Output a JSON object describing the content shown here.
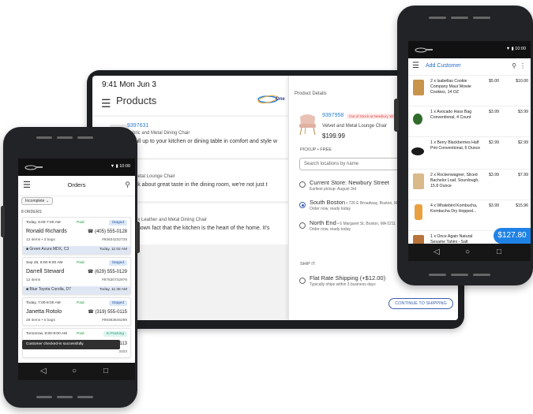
{
  "tablet": {
    "status_time": "9:41",
    "status_date": "Mon Jun 3",
    "title": "Products",
    "logo_text": "One",
    "list": [
      {
        "sku": "9397631",
        "name": "Fabric and Metal Dining Chair",
        "desc": "'ll pull up to your kitchen or dining table in comfort and style w"
      },
      {
        "sku": "3",
        "name": "nd Metal Lounge Chair",
        "desc": "e talk about great taste in the dining room, we're not just t"
      },
      {
        "sku": "5",
        "name": "l Faux Leather and Metal Dining Chair",
        "desc": "ell-known fact that the kitchen is the heart of the home. It's"
      }
    ],
    "details": {
      "header": "Product Details",
      "sku": "9397958",
      "badge": "Out of Stock at Newbury Street",
      "name": "Velvet and Metal Lounge Chair",
      "price": "$199.99",
      "pickup_label": "PICKUP • FREE",
      "search_placeholder": "Search locations by name",
      "options": [
        {
          "name": "Current Store: Newbury Street",
          "detail": "",
          "sub": "Earliest pickup: August 3rd"
        },
        {
          "name": "South Boston",
          "detail": " • 726 E Broadway, Boston, Ma",
          "sub": "Order now, ready today"
        },
        {
          "name": "North End",
          "detail": " • 6 Margaret St, Boston, MA 0211",
          "sub": "Order now, ready today"
        }
      ],
      "ship_label": "SHIP IT",
      "ship_option": {
        "name": "Flat Rate Shipping (+$12.00)",
        "sub": "Typically ships within 3 business days"
      },
      "continue_label": "CONTINUE TO SHIPPING"
    }
  },
  "left_phone": {
    "status_time": "10:00",
    "title": "Orders",
    "filter": "Incomplete",
    "count": "8 ORDERS",
    "orders": [
      {
        "time": "Today, 6:00-7:00 AM",
        "paid": "Paid",
        "status": "Staged",
        "name": "Ronald Richards",
        "phone": "(405) 555-0128",
        "items": "12 items • 3 bags",
        "order_no": "#93634232725",
        "car": "Green Acura MDX, C3",
        "ready": "Today, 11:02 AM"
      },
      {
        "time": "Sep 28, 8:00-9:00 AM",
        "paid": "Paid",
        "status": "Staged",
        "name": "Darrell Steward",
        "phone": "(629) 555-0129",
        "items": "12 items",
        "order_no": "#87530742976",
        "car": "Blue Toyota Corolla, D7",
        "ready": "Today, 11:38 AM"
      },
      {
        "time": "Today, 7:00-8:00 AM",
        "paid": "Paid",
        "status": "Staged",
        "name": "Janetta Rotolo",
        "phone": "(319) 555-0115",
        "items": "28 items • 5 bags",
        "order_no": "#99383645289",
        "car": "",
        "ready": ""
      },
      {
        "time": "Tomorrow, 8:00-9:00 AM",
        "paid": "Paid",
        "status": "In Packing",
        "name": "",
        "phone": "0113",
        "items": "",
        "order_no": "3103",
        "car": "",
        "ready": ""
      }
    ],
    "toast": "Customer checked-in successfully."
  },
  "right_phone": {
    "status_time": "10:00",
    "title": "Add Customer",
    "items": [
      {
        "name": "2 x Isabellas Cookie Company Maui Wowie Cookies, 14 OZ",
        "unit": "$5.00",
        "total": "$10.00",
        "color": "#c8944c"
      },
      {
        "name": "1 x Avocado Hass Bag Conventional, 4 Count",
        "unit": "$3.99",
        "total": "$3.99",
        "color": "#2f6b2a"
      },
      {
        "name": "1 x Berry Blackberries Half Pint Conventional, 6 Ounce",
        "unit": "$2.99",
        "total": "$2.99",
        "color": "#1a1a1a"
      },
      {
        "name": "2 x Rockenwagner, Sliced Bachelor Loaf, Sourdough, 15.8 Ounce",
        "unit": "$3.99",
        "total": "$7.99",
        "color": "#d9b98a"
      },
      {
        "name": "4 x Whalebird Kombucha, Kombucha Dry Hopped...",
        "unit": "$3.99",
        "total": "$15.96",
        "color": "#e8a040"
      },
      {
        "name": "1 x Once Again Natural Sesame Tahini - Salt",
        "unit": "",
        "total": "",
        "color": "#b8743a"
      }
    ],
    "total": "$127.80"
  },
  "colors": {
    "accent": "#2a6cc7",
    "paid": "#1b9e3e",
    "fab": "#1f82e6"
  }
}
